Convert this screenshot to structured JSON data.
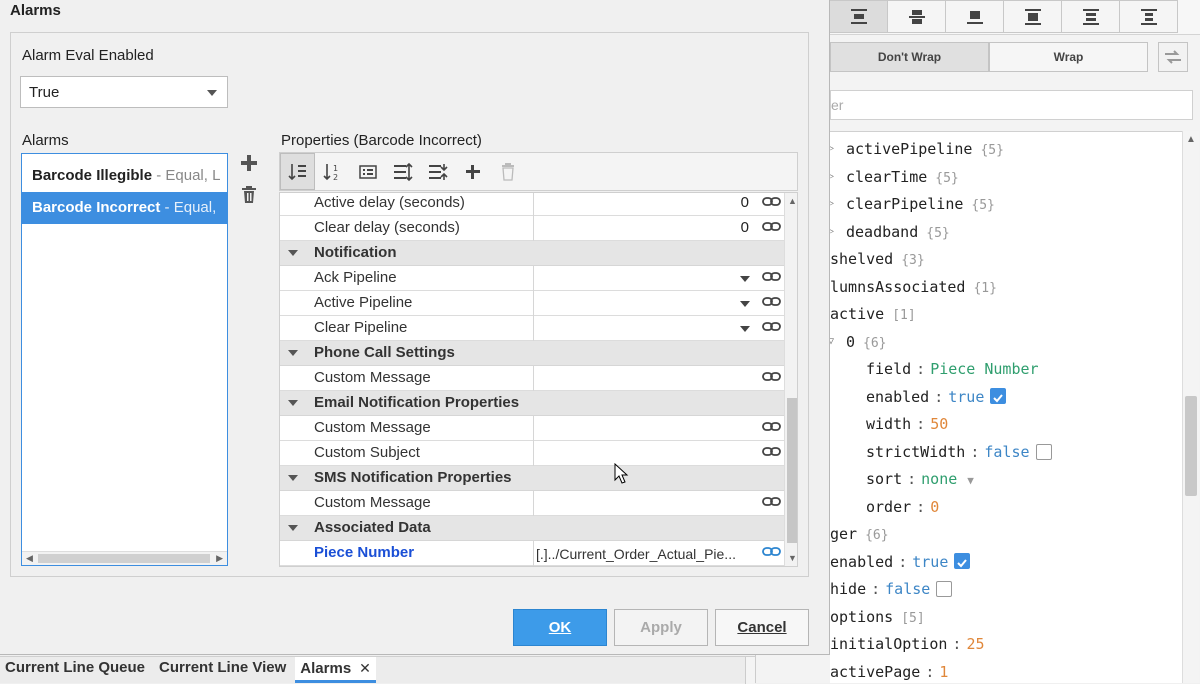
{
  "dialog": {
    "title": "Alarms",
    "alarm_eval_label": "Alarm Eval Enabled",
    "alarm_eval_value": "True",
    "alarms_label": "Alarms",
    "properties_label": "Properties (Barcode Incorrect)",
    "alarms": [
      {
        "name": "Barcode Illegible",
        "detail": " - Equal, L"
      },
      {
        "name": "Barcode Incorrect",
        "detail": " - Equal,"
      }
    ],
    "props": {
      "active_delay": {
        "label": "Active delay (seconds)",
        "value": "0"
      },
      "clear_delay": {
        "label": "Clear delay (seconds)",
        "value": "0"
      },
      "notification": "Notification",
      "ack_pipeline": "Ack Pipeline",
      "active_pipeline": "Active Pipeline",
      "clear_pipeline": "Clear Pipeline",
      "phone_call": "Phone Call Settings",
      "phone_custom_message": "Custom Message",
      "email": "Email Notification Properties",
      "email_custom_message": "Custom Message",
      "email_custom_subject": "Custom Subject",
      "sms": "SMS Notification Properties",
      "sms_custom_message": "Custom Message",
      "associated": "Associated Data",
      "piece_number": {
        "label": "Piece Number",
        "value": "[.]../Current_Order_Actual_Pie..."
      }
    },
    "buttons": {
      "ok": "OK",
      "apply": "Apply",
      "cancel": "Cancel"
    }
  },
  "tabs": [
    {
      "label": "Current Line Queue"
    },
    {
      "label": "Current Line View"
    },
    {
      "label": "Alarms",
      "close": "✕"
    }
  ],
  "right_panel": {
    "wrap_off": "Don't Wrap",
    "wrap_on": "Wrap",
    "filter_text": "er",
    "tree": {
      "activePipeline": {
        "key": "activePipeline",
        "count": "{5}"
      },
      "clearTime": {
        "key": "clearTime",
        "count": "{5}"
      },
      "clearPipeline": {
        "key": "clearPipeline",
        "count": "{5}"
      },
      "deadband": {
        "key": "deadband",
        "count": "{5}"
      },
      "shelved": {
        "key": "shelved",
        "count": "{3}"
      },
      "columnsAssociated": {
        "key": "lumnsAssociated",
        "count": "{1}"
      },
      "active": {
        "key": "active",
        "count": "[1]"
      },
      "zero": {
        "key": "0",
        "count": "{6}"
      },
      "field": {
        "key": "field",
        "value": "Piece Number"
      },
      "enabled": {
        "key": "enabled",
        "value": "true"
      },
      "width": {
        "key": "width",
        "value": "50"
      },
      "strictWidth": {
        "key": "strictWidth",
        "value": "false"
      },
      "sort": {
        "key": "sort",
        "value": "none"
      },
      "order": {
        "key": "order",
        "value": "0"
      },
      "pager": {
        "key": "ger",
        "count": "{6}"
      },
      "pager_enabled": {
        "key": "enabled",
        "value": "true"
      },
      "hide": {
        "key": "hide",
        "value": "false"
      },
      "options": {
        "key": "options",
        "count": "[5]"
      },
      "initialOption": {
        "key": "initialOption",
        "value": "25"
      },
      "activePage": {
        "key": "activePage",
        "value": "1"
      }
    }
  }
}
